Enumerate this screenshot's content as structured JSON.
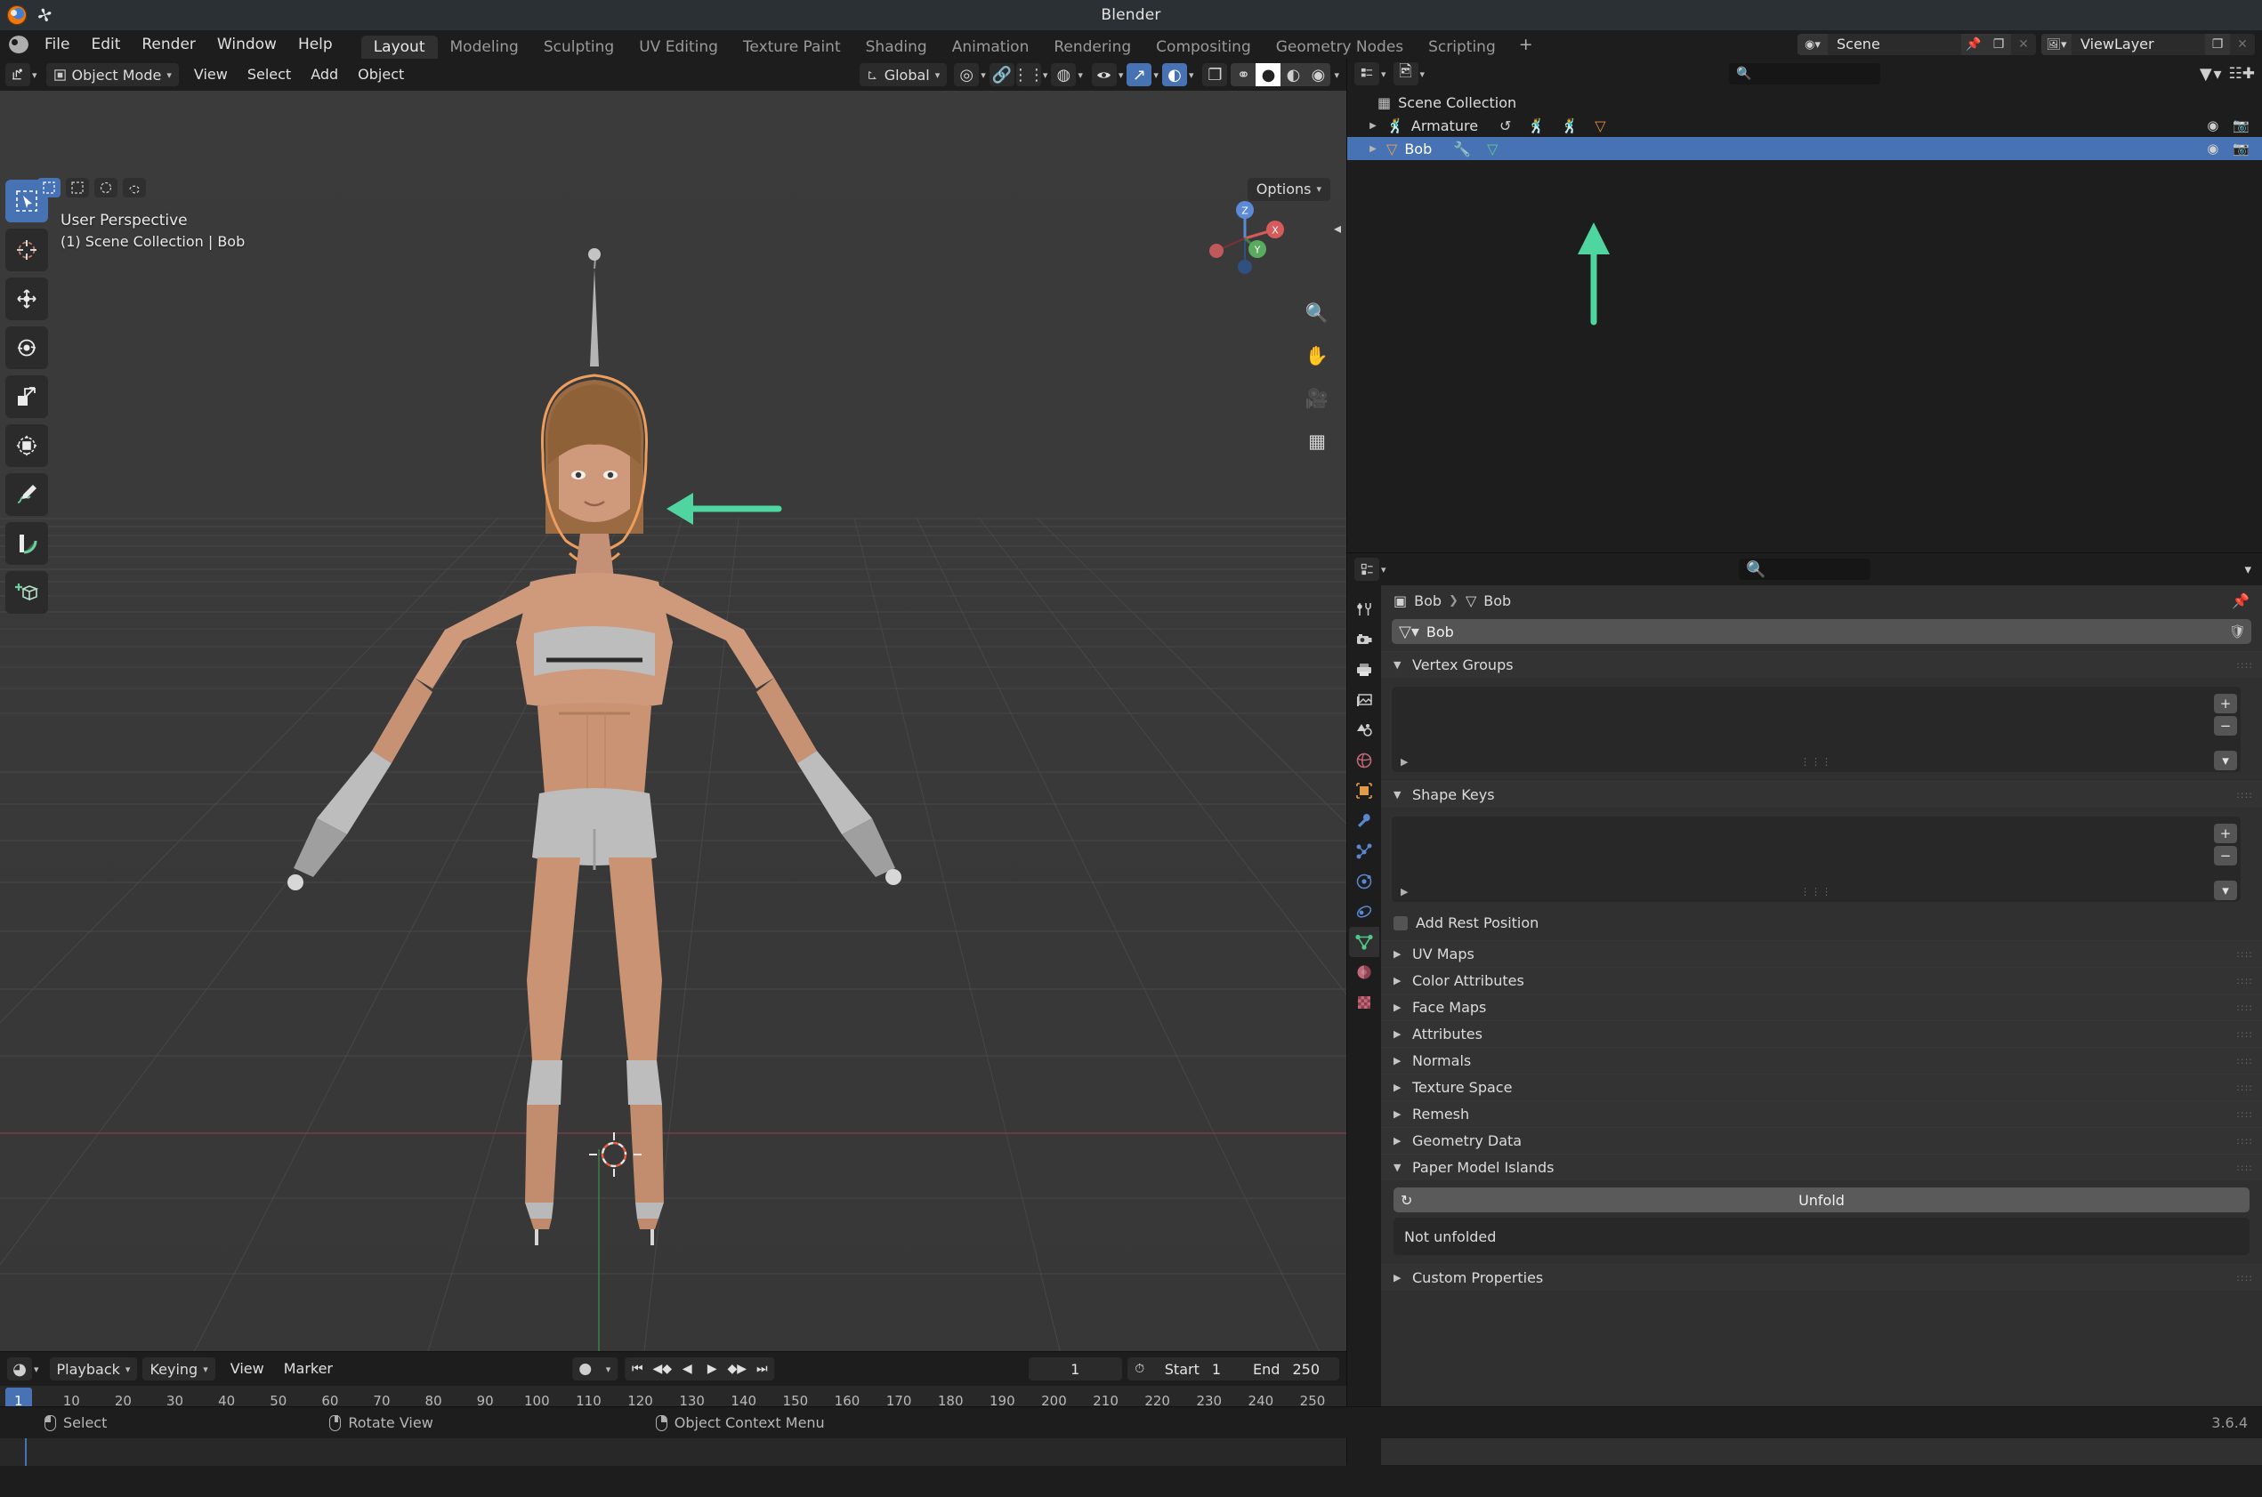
{
  "window": {
    "title": "Blender",
    "version": "3.6.4"
  },
  "topbar": {
    "menus": [
      "File",
      "Edit",
      "Render",
      "Window",
      "Help"
    ],
    "workspaces": [
      "Layout",
      "Modeling",
      "Sculpting",
      "UV Editing",
      "Texture Paint",
      "Shading",
      "Animation",
      "Rendering",
      "Compositing",
      "Geometry Nodes",
      "Scripting"
    ],
    "active_workspace": "Layout",
    "add_workspace_label": "+",
    "scene_name": "Scene",
    "viewlayer_name": "ViewLayer"
  },
  "viewport": {
    "mode": "Object Mode",
    "menus": [
      "View",
      "Select",
      "Add",
      "Object"
    ],
    "transform_orientation": "Global",
    "options_label": "Options",
    "overlay_line1": "User Perspective",
    "overlay_line2": "(1) Scene Collection | Bob",
    "gizmo_axes": [
      "X",
      "Y",
      "Z"
    ]
  },
  "outliner": {
    "search_placeholder": "",
    "rows": [
      {
        "label": "Scene Collection",
        "icon": "collection-icon",
        "selected": false,
        "indent": 0,
        "has_disclosure": false
      },
      {
        "label": "Armature",
        "icon": "armature-icon",
        "selected": false,
        "indent": 1,
        "has_disclosure": true
      },
      {
        "label": "Bob",
        "icon": "mesh-data-icon",
        "selected": true,
        "indent": 1,
        "has_disclosure": true
      }
    ]
  },
  "properties": {
    "search_placeholder": "",
    "breadcrumb": [
      "Bob",
      "Bob"
    ],
    "datablock_name": "Bob",
    "tabs": [
      "tool-icon",
      "render-icon",
      "output-icon",
      "viewlayer-icon",
      "scene-icon",
      "world-icon",
      "object-icon",
      "modifier-icon",
      "particles-icon",
      "physics-icon",
      "constraint-icon",
      "object-data-icon",
      "material-icon",
      "texture-icon"
    ],
    "active_tab": "object-data-icon",
    "panels": [
      {
        "label": "Vertex Groups",
        "open": true,
        "type": "list"
      },
      {
        "label": "Shape Keys",
        "open": true,
        "type": "list"
      },
      {
        "label": "UV Maps",
        "open": false,
        "type": "simple"
      },
      {
        "label": "Color Attributes",
        "open": false,
        "type": "simple"
      },
      {
        "label": "Face Maps",
        "open": false,
        "type": "simple"
      },
      {
        "label": "Attributes",
        "open": false,
        "type": "simple"
      },
      {
        "label": "Normals",
        "open": false,
        "type": "simple"
      },
      {
        "label": "Texture Space",
        "open": false,
        "type": "simple"
      },
      {
        "label": "Remesh",
        "open": false,
        "type": "simple"
      },
      {
        "label": "Geometry Data",
        "open": false,
        "type": "simple"
      },
      {
        "label": "Paper Model Islands",
        "open": true,
        "type": "paper"
      },
      {
        "label": "Custom Properties",
        "open": false,
        "type": "simple"
      }
    ],
    "add_rest_position_label": "Add Rest Position",
    "unfold_button_label": "Unfold",
    "unfold_status": "Not unfolded"
  },
  "timeline": {
    "menus": [
      "Playback",
      "Keying",
      "View",
      "Marker"
    ],
    "current_frame": "1",
    "start_label": "Start",
    "start_value": "1",
    "end_label": "End",
    "end_value": "250",
    "ruler_ticks": [
      "1",
      "10",
      "20",
      "30",
      "40",
      "50",
      "60",
      "70",
      "80",
      "90",
      "100",
      "110",
      "120",
      "130",
      "140",
      "150",
      "160",
      "170",
      "180",
      "190",
      "200",
      "210",
      "220",
      "230",
      "240",
      "250"
    ],
    "playhead_frame": "1"
  },
  "statusbar": {
    "items": [
      {
        "mouse": "left",
        "label": "Select"
      },
      {
        "mouse": "middle",
        "label": "Rotate View"
      },
      {
        "mouse": "right",
        "label": "Object Context Menu"
      }
    ],
    "version": "3.6.4"
  },
  "annotations": {
    "arrow_color": "#4fd6a0",
    "arrow_head_to_model": "left-pointing arrow at character head",
    "arrow_up_to_outliner": "up-pointing arrow to Bob outliner row"
  },
  "colors": {
    "accent_blue": "#4772b3",
    "panel_bg": "#303030",
    "editor_bg": "#1d1d1d",
    "viewport_bg": "#393939",
    "selection_outline": "#ed9e5c"
  }
}
